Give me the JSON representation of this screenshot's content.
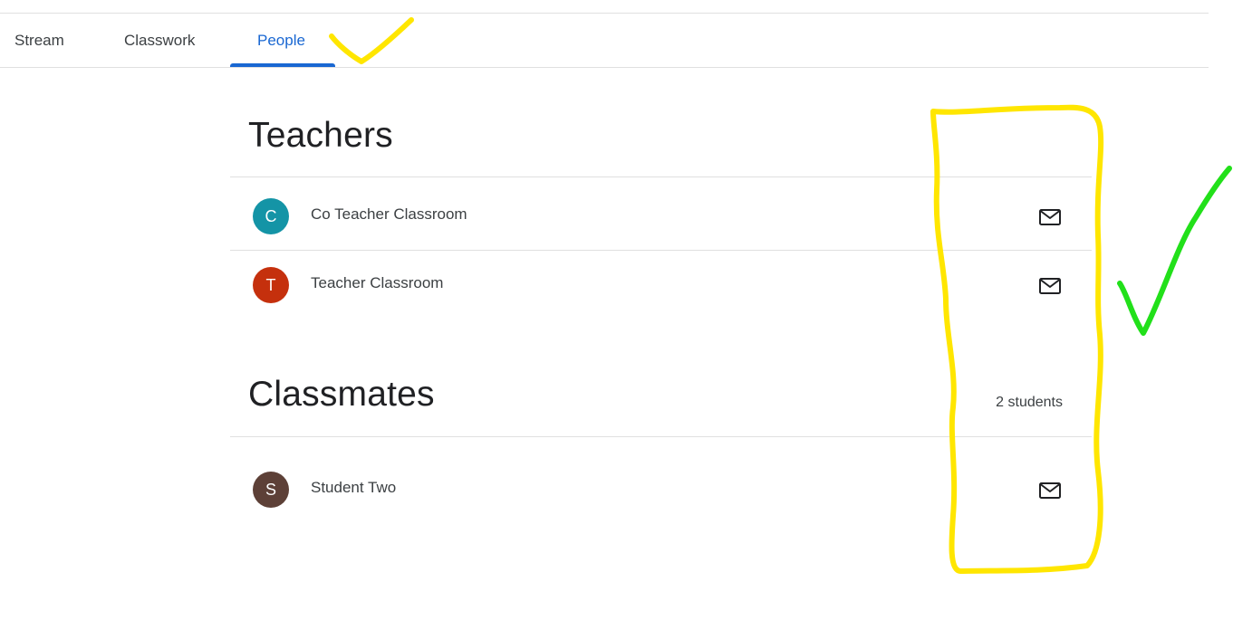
{
  "tabs": [
    {
      "label": "Stream"
    },
    {
      "label": "Classwork"
    },
    {
      "label": "People"
    }
  ],
  "active_tab": "People",
  "accent_color": "#1967d2",
  "teachers": {
    "title": "Teachers",
    "people": [
      {
        "initial": "C",
        "name": "Co Teacher Classroom",
        "avatar_color": "#1494a6",
        "action_icon": "mail-icon"
      },
      {
        "initial": "T",
        "name": "Teacher Classroom",
        "avatar_color": "#c5300d",
        "action_icon": "mail-icon"
      }
    ]
  },
  "classmates": {
    "title": "Classmates",
    "count": "2 students",
    "people": [
      {
        "initial": "S",
        "name": "Student Two",
        "avatar_color": "#5d4037",
        "action_icon": "mail-icon"
      }
    ]
  },
  "annotations": {
    "highlight_color": "#ffe600",
    "check_color": "#22e01a"
  }
}
